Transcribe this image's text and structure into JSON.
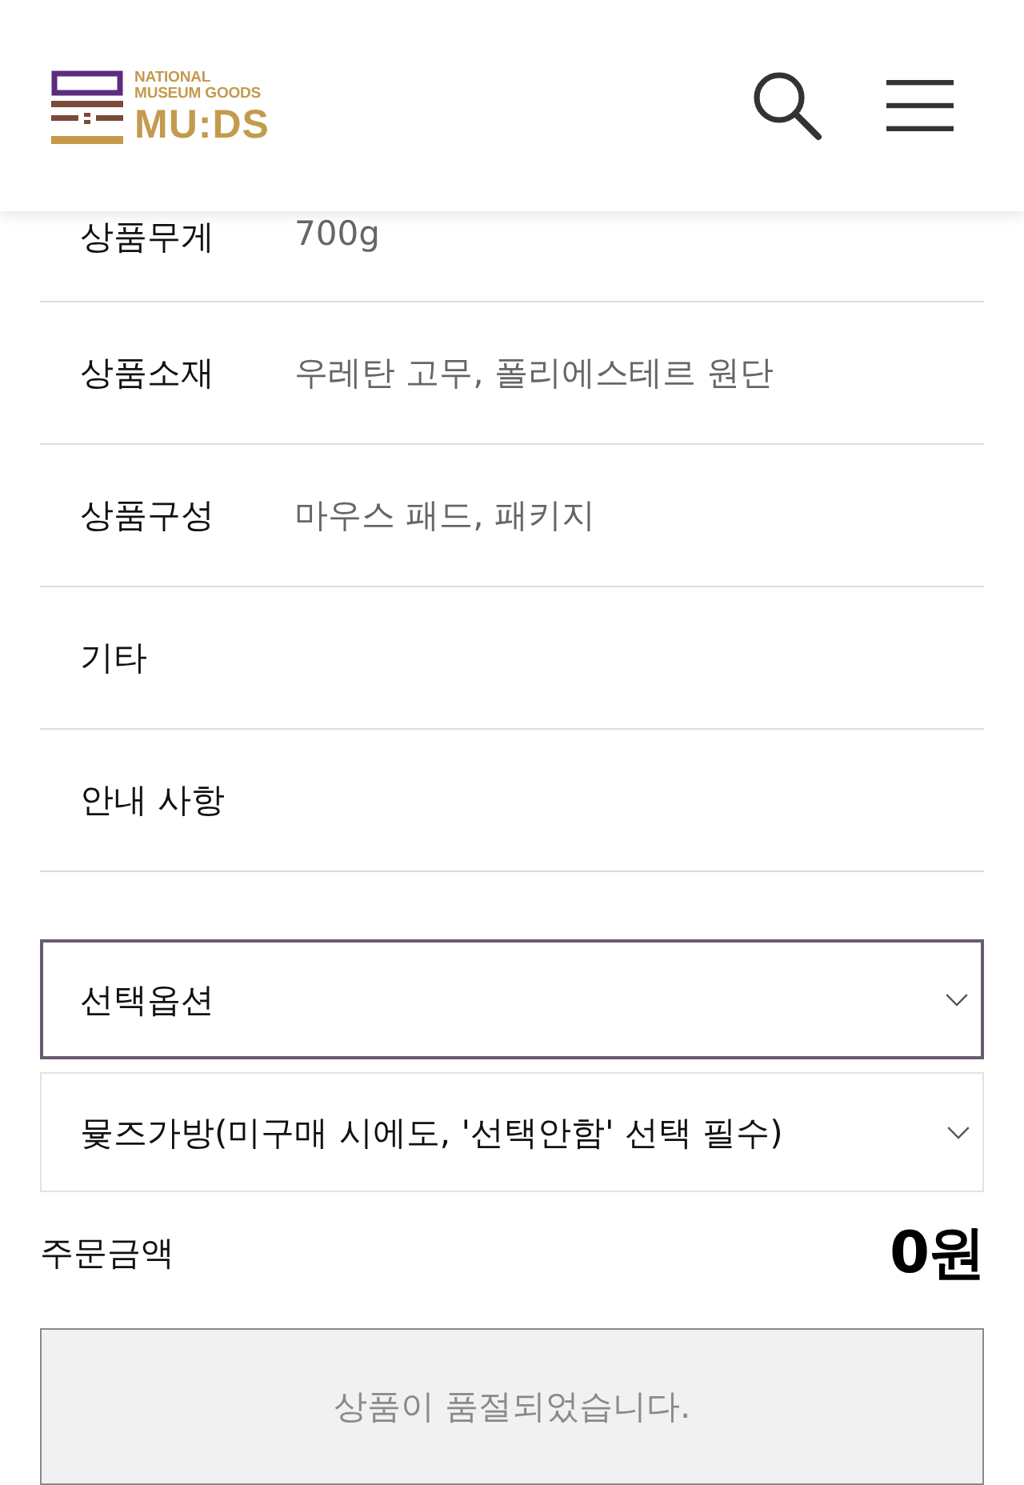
{
  "header": {
    "logo": {
      "line_1": "NATIONAL",
      "line_2": "MUSEUM GOODS",
      "wordmark": "MU:DS"
    }
  },
  "details": [
    {
      "label": "상품무게",
      "value": "700g"
    },
    {
      "label": "상품소재",
      "value": "우레탄 고무, 폴리에스테르 원단"
    },
    {
      "label": "상품구성",
      "value": "마우스 패드, 패키지"
    },
    {
      "label": "기타"
    },
    {
      "label": "안내 사항"
    }
  ],
  "options": [
    {
      "label": "선택옵션",
      "focused": true
    },
    {
      "label": "뮻즈가방(미구매 시에도, '선택안함' 선택 필수)",
      "focused": false
    }
  ],
  "order_total": {
    "label": "주문금액",
    "amount": "0원"
  },
  "purchase_button": {
    "label": "상품이 품절되었습니다.",
    "disabled": true
  }
}
